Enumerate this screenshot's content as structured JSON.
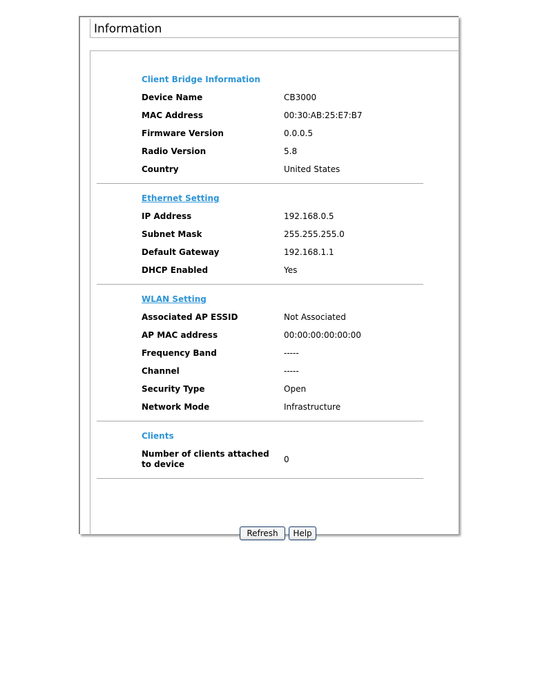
{
  "window": {
    "title": "Information"
  },
  "sections": {
    "client_bridge": {
      "title": "Client Bridge Information",
      "rows": [
        {
          "label": "Device Name",
          "value": "CB3000"
        },
        {
          "label": "MAC Address",
          "value": "00:30:AB:25:E7:B7"
        },
        {
          "label": "Firmware Version",
          "value": "0.0.0.5"
        },
        {
          "label": "Radio Version",
          "value": "5.8"
        },
        {
          "label": "Country",
          "value": "United States"
        }
      ]
    },
    "ethernet": {
      "title": "Ethernet Setting",
      "rows": [
        {
          "label": "IP Address",
          "value": "192.168.0.5"
        },
        {
          "label": "Subnet Mask",
          "value": "255.255.255.0"
        },
        {
          "label": "Default Gateway",
          "value": "192.168.1.1"
        },
        {
          "label": "DHCP Enabled",
          "value": "Yes"
        }
      ]
    },
    "wlan": {
      "title": "WLAN Setting",
      "rows": [
        {
          "label": "Associated AP ESSID",
          "value": "Not Associated"
        },
        {
          "label": "AP MAC address",
          "value": "00:00:00:00:00:00"
        },
        {
          "label": "Frequency Band",
          "value": "-----"
        },
        {
          "label": "Channel",
          "value": "-----"
        },
        {
          "label": "Security Type",
          "value": "Open"
        },
        {
          "label": "Network Mode",
          "value": "Infrastructure"
        }
      ]
    },
    "clients": {
      "title": "Clients",
      "rows": [
        {
          "label": "Number of clients attached to device",
          "value": "0"
        }
      ]
    }
  },
  "buttons": {
    "refresh": "Refresh",
    "help": "Help"
  },
  "colors": {
    "section_heading": "#2f95d6",
    "divider": "#a8a8a8",
    "button_border": "#1c3f6e"
  }
}
